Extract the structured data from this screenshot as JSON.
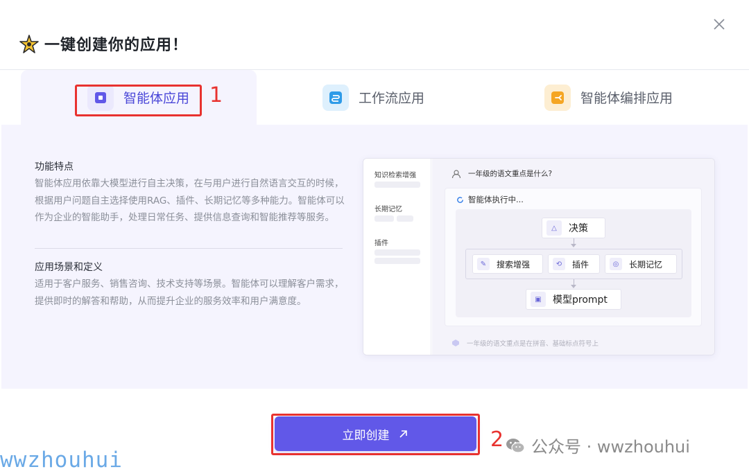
{
  "header": {
    "title": "一键创建你的应用！"
  },
  "tabs": [
    {
      "label": "智能体应用",
      "icon": "agent-app-icon",
      "active": true,
      "color": "#6158e8"
    },
    {
      "label": "工作流应用",
      "icon": "workflow-icon",
      "active": false,
      "color": "#2e9be8"
    },
    {
      "label": "智能体编排应用",
      "icon": "orchestration-icon",
      "active": false,
      "color": "#f5a623"
    }
  ],
  "content": {
    "features_title": "功能特点",
    "features_text": "智能体应用依靠大模型进行自主决策，在与用户进行自然语言交互的时候，根据用户问题自主选择使用RAG、插件、长期记忆等多种能力。智能体可以作为企业的智能助手，处理日常任务、提供信息查询和智能推荐等服务。",
    "scenarios_title": "应用场景和定义",
    "scenarios_text": "适用于客户服务、销售咨询、技术支持等场景。智能体可以理解客户需求，提供即时的解答和帮助，从而提升企业的服务效率和用户满意度。"
  },
  "preview": {
    "sidebar": [
      "知识检索增强",
      "长期记忆",
      "插件"
    ],
    "question": "一年级的语文重点是什么?",
    "status": "智能体执行中...",
    "nodes": {
      "decision": "决策",
      "rag": "搜索增强",
      "plugin": "插件",
      "memory": "长期记忆",
      "model": "模型prompt"
    },
    "answer": "一年级的语文重点是在拼音、基础标点符号上"
  },
  "footer": {
    "create_label": "立即创建"
  },
  "annotations": {
    "num1": "1",
    "num2": "2",
    "color": "#e8322f"
  },
  "watermarks": {
    "left": "wwzhouhui",
    "right": "公众号 · wwzhouhui"
  },
  "colors": {
    "accent": "#6158e8",
    "panel_bg": "#f5f4fe"
  }
}
